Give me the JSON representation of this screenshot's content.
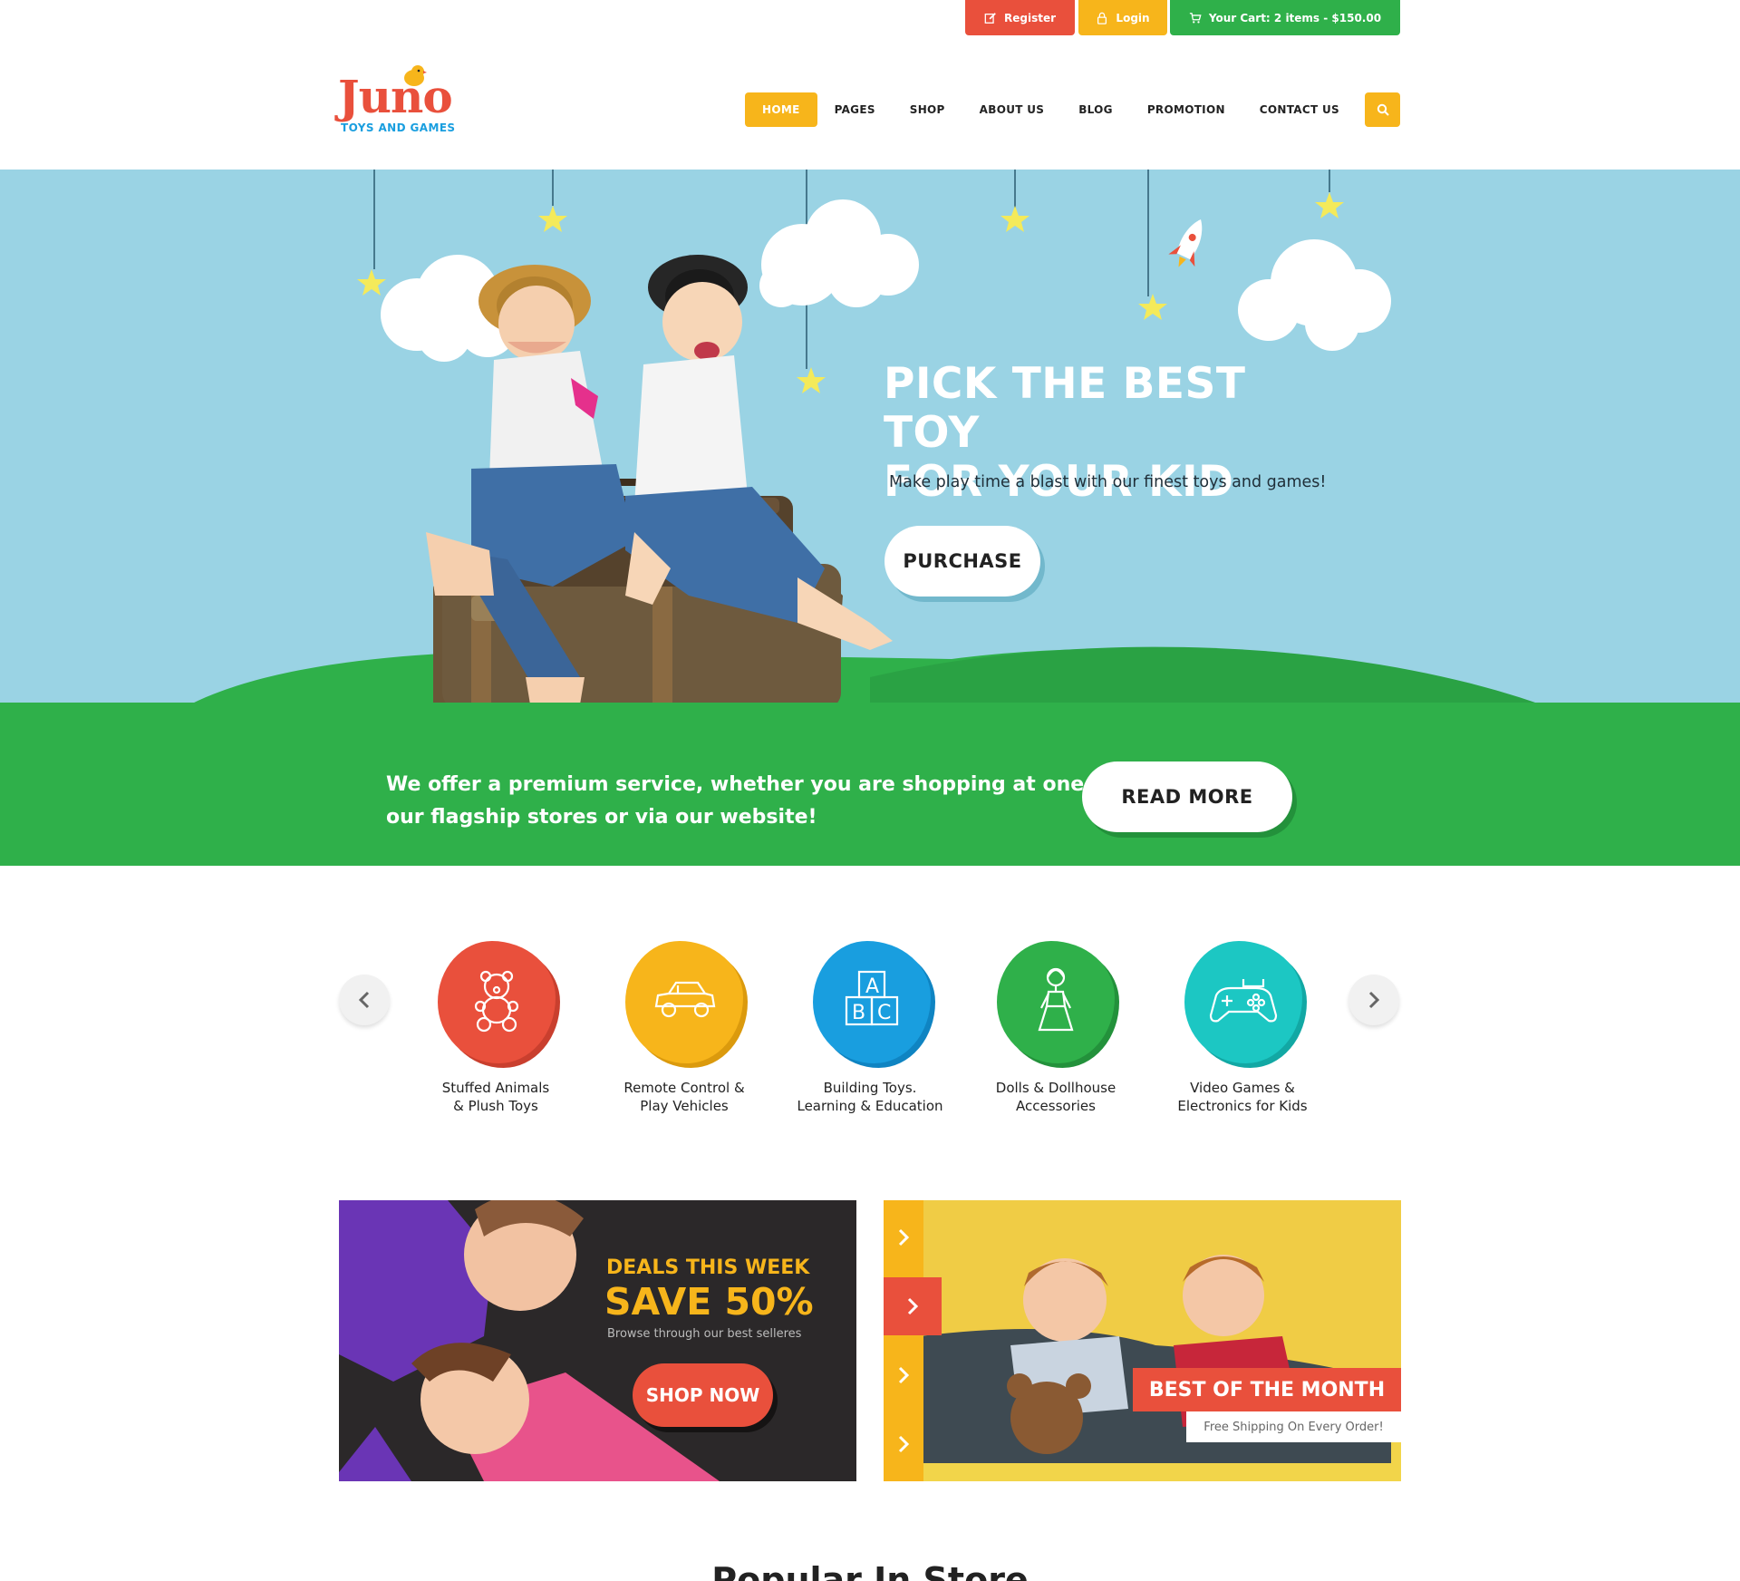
{
  "topbar": {
    "register": "Register",
    "login": "Login",
    "cart": "Your Cart: 2 items - $150.00"
  },
  "logo": {
    "name": "Juno",
    "tagline": "TOYS AND GAMES"
  },
  "nav": {
    "items": [
      "HOME",
      "PAGES",
      "SHOP",
      "ABOUT US",
      "BLOG",
      "PROMOTION",
      "CONTACT US"
    ],
    "active": "HOME"
  },
  "hero": {
    "title_line1": "PICK THE BEST TOY",
    "title_line2": "FOR YOUR KID",
    "subtitle": "Make play time a blast with our finest toys and games!",
    "cta": "PURCHASE",
    "slides": 3
  },
  "promo_strip": {
    "text_line1": "We offer a premium service, whether you are shopping at one of",
    "text_line2": "our flagship stores or via our website!",
    "cta": "READ MORE"
  },
  "categories": [
    {
      "line1": "Stuffed Animals",
      "line2": "& Plush Toys",
      "icon": "teddy-bear-icon",
      "color": "#e9503c"
    },
    {
      "line1": "Remote Control &",
      "line2": "Play Vehicles",
      "icon": "car-icon",
      "color": "#f7b51b"
    },
    {
      "line1": "Building Toys.",
      "line2": "Learning & Education",
      "icon": "abc-blocks-icon",
      "color": "#199edf"
    },
    {
      "line1": "Dolls & Dollhouse",
      "line2": "Accessories",
      "icon": "doll-icon",
      "color": "#2fb04a"
    },
    {
      "line1": "Video Games &",
      "line2": "Electronics for Kids",
      "icon": "gamepad-icon",
      "color": "#1cc7c3"
    }
  ],
  "banners": {
    "deals": {
      "kicker": "DEALS THIS WEEK",
      "headline": "SAVE 50%",
      "sub": "Browse through our best selleres",
      "cta": "SHOP NOW"
    },
    "best": {
      "title": "BEST OF THE MONTH",
      "sub": "Free Shipping On Every Order!"
    }
  },
  "section_heading_partial": "Popular In Store",
  "colors": {
    "red": "#e9503c",
    "yellow": "#f7b51b",
    "green": "#2fb04a",
    "sky": "#9ad3e4",
    "blue": "#199edf",
    "teal": "#1cc7c3"
  }
}
